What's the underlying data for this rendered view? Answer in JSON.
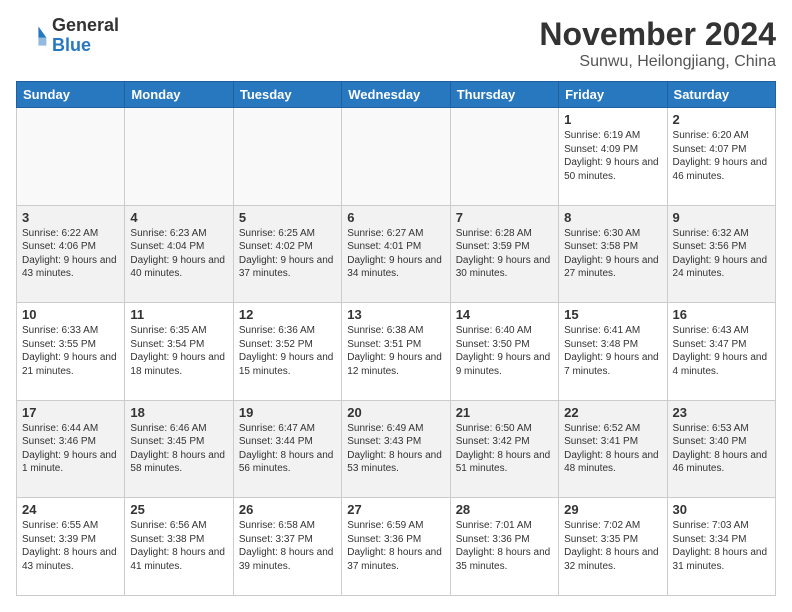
{
  "header": {
    "logo": {
      "general": "General",
      "blue": "Blue"
    },
    "title": "November 2024",
    "location": "Sunwu, Heilongjiang, China"
  },
  "days_of_week": [
    "Sunday",
    "Monday",
    "Tuesday",
    "Wednesday",
    "Thursday",
    "Friday",
    "Saturday"
  ],
  "weeks": [
    [
      {
        "day": "",
        "info": ""
      },
      {
        "day": "",
        "info": ""
      },
      {
        "day": "",
        "info": ""
      },
      {
        "day": "",
        "info": ""
      },
      {
        "day": "",
        "info": ""
      },
      {
        "day": "1",
        "info": "Sunrise: 6:19 AM\nSunset: 4:09 PM\nDaylight: 9 hours and 50 minutes."
      },
      {
        "day": "2",
        "info": "Sunrise: 6:20 AM\nSunset: 4:07 PM\nDaylight: 9 hours and 46 minutes."
      }
    ],
    [
      {
        "day": "3",
        "info": "Sunrise: 6:22 AM\nSunset: 4:06 PM\nDaylight: 9 hours and 43 minutes."
      },
      {
        "day": "4",
        "info": "Sunrise: 6:23 AM\nSunset: 4:04 PM\nDaylight: 9 hours and 40 minutes."
      },
      {
        "day": "5",
        "info": "Sunrise: 6:25 AM\nSunset: 4:02 PM\nDaylight: 9 hours and 37 minutes."
      },
      {
        "day": "6",
        "info": "Sunrise: 6:27 AM\nSunset: 4:01 PM\nDaylight: 9 hours and 34 minutes."
      },
      {
        "day": "7",
        "info": "Sunrise: 6:28 AM\nSunset: 3:59 PM\nDaylight: 9 hours and 30 minutes."
      },
      {
        "day": "8",
        "info": "Sunrise: 6:30 AM\nSunset: 3:58 PM\nDaylight: 9 hours and 27 minutes."
      },
      {
        "day": "9",
        "info": "Sunrise: 6:32 AM\nSunset: 3:56 PM\nDaylight: 9 hours and 24 minutes."
      }
    ],
    [
      {
        "day": "10",
        "info": "Sunrise: 6:33 AM\nSunset: 3:55 PM\nDaylight: 9 hours and 21 minutes."
      },
      {
        "day": "11",
        "info": "Sunrise: 6:35 AM\nSunset: 3:54 PM\nDaylight: 9 hours and 18 minutes."
      },
      {
        "day": "12",
        "info": "Sunrise: 6:36 AM\nSunset: 3:52 PM\nDaylight: 9 hours and 15 minutes."
      },
      {
        "day": "13",
        "info": "Sunrise: 6:38 AM\nSunset: 3:51 PM\nDaylight: 9 hours and 12 minutes."
      },
      {
        "day": "14",
        "info": "Sunrise: 6:40 AM\nSunset: 3:50 PM\nDaylight: 9 hours and 9 minutes."
      },
      {
        "day": "15",
        "info": "Sunrise: 6:41 AM\nSunset: 3:48 PM\nDaylight: 9 hours and 7 minutes."
      },
      {
        "day": "16",
        "info": "Sunrise: 6:43 AM\nSunset: 3:47 PM\nDaylight: 9 hours and 4 minutes."
      }
    ],
    [
      {
        "day": "17",
        "info": "Sunrise: 6:44 AM\nSunset: 3:46 PM\nDaylight: 9 hours and 1 minute."
      },
      {
        "day": "18",
        "info": "Sunrise: 6:46 AM\nSunset: 3:45 PM\nDaylight: 8 hours and 58 minutes."
      },
      {
        "day": "19",
        "info": "Sunrise: 6:47 AM\nSunset: 3:44 PM\nDaylight: 8 hours and 56 minutes."
      },
      {
        "day": "20",
        "info": "Sunrise: 6:49 AM\nSunset: 3:43 PM\nDaylight: 8 hours and 53 minutes."
      },
      {
        "day": "21",
        "info": "Sunrise: 6:50 AM\nSunset: 3:42 PM\nDaylight: 8 hours and 51 minutes."
      },
      {
        "day": "22",
        "info": "Sunrise: 6:52 AM\nSunset: 3:41 PM\nDaylight: 8 hours and 48 minutes."
      },
      {
        "day": "23",
        "info": "Sunrise: 6:53 AM\nSunset: 3:40 PM\nDaylight: 8 hours and 46 minutes."
      }
    ],
    [
      {
        "day": "24",
        "info": "Sunrise: 6:55 AM\nSunset: 3:39 PM\nDaylight: 8 hours and 43 minutes."
      },
      {
        "day": "25",
        "info": "Sunrise: 6:56 AM\nSunset: 3:38 PM\nDaylight: 8 hours and 41 minutes."
      },
      {
        "day": "26",
        "info": "Sunrise: 6:58 AM\nSunset: 3:37 PM\nDaylight: 8 hours and 39 minutes."
      },
      {
        "day": "27",
        "info": "Sunrise: 6:59 AM\nSunset: 3:36 PM\nDaylight: 8 hours and 37 minutes."
      },
      {
        "day": "28",
        "info": "Sunrise: 7:01 AM\nSunset: 3:36 PM\nDaylight: 8 hours and 35 minutes."
      },
      {
        "day": "29",
        "info": "Sunrise: 7:02 AM\nSunset: 3:35 PM\nDaylight: 8 hours and 32 minutes."
      },
      {
        "day": "30",
        "info": "Sunrise: 7:03 AM\nSunset: 3:34 PM\nDaylight: 8 hours and 31 minutes."
      }
    ]
  ]
}
